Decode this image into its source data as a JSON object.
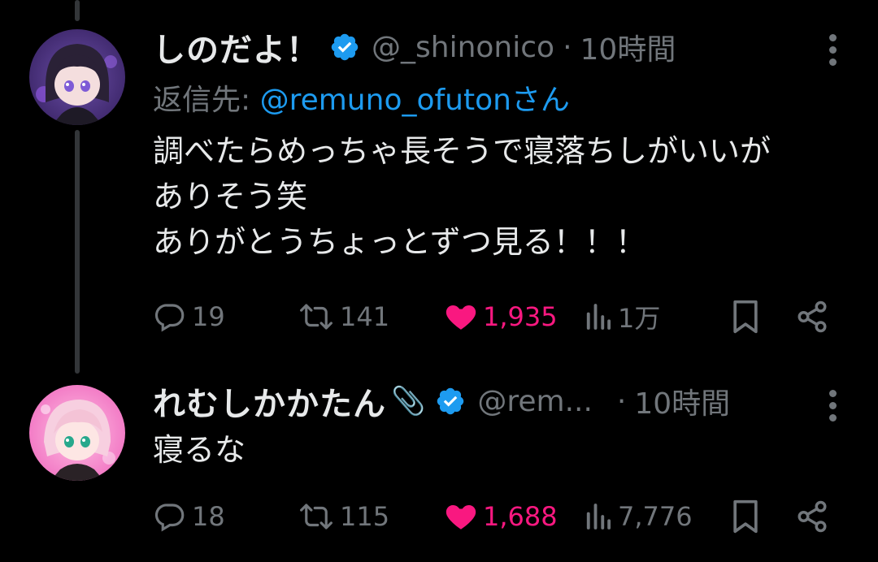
{
  "colors": {
    "background": "#000000",
    "text_primary": "#e7e9ea",
    "text_secondary": "#71767b",
    "accent_blue": "#1d9bf0",
    "like_pink": "#f91880"
  },
  "tweets": [
    {
      "display_name": "しのだよ！",
      "verified_icon": "verified-badge-icon",
      "handle": "@_shinonico",
      "separator": "·",
      "time": "10時間",
      "reply_prefix": "返信先: ",
      "reply_mention": "@remuno_ofutonさん",
      "text_lines": [
        "調べたらめっちゃ長そうで寝落ちしがいいが",
        "ありそう笑",
        "ありがとうちょっとずつ見る！！！"
      ],
      "stats": {
        "replies": "19",
        "retweets": "141",
        "likes": "1,935",
        "views": "1万"
      }
    },
    {
      "display_name": "れむしかかたん",
      "name_emoji": "📎",
      "verified_icon": "verified-badge-icon",
      "handle": "@rem...",
      "separator": "·",
      "time": "10時間",
      "text_lines": [
        "寝るな"
      ],
      "stats": {
        "replies": "18",
        "retweets": "115",
        "likes": "1,688",
        "views": "7,776"
      }
    }
  ]
}
